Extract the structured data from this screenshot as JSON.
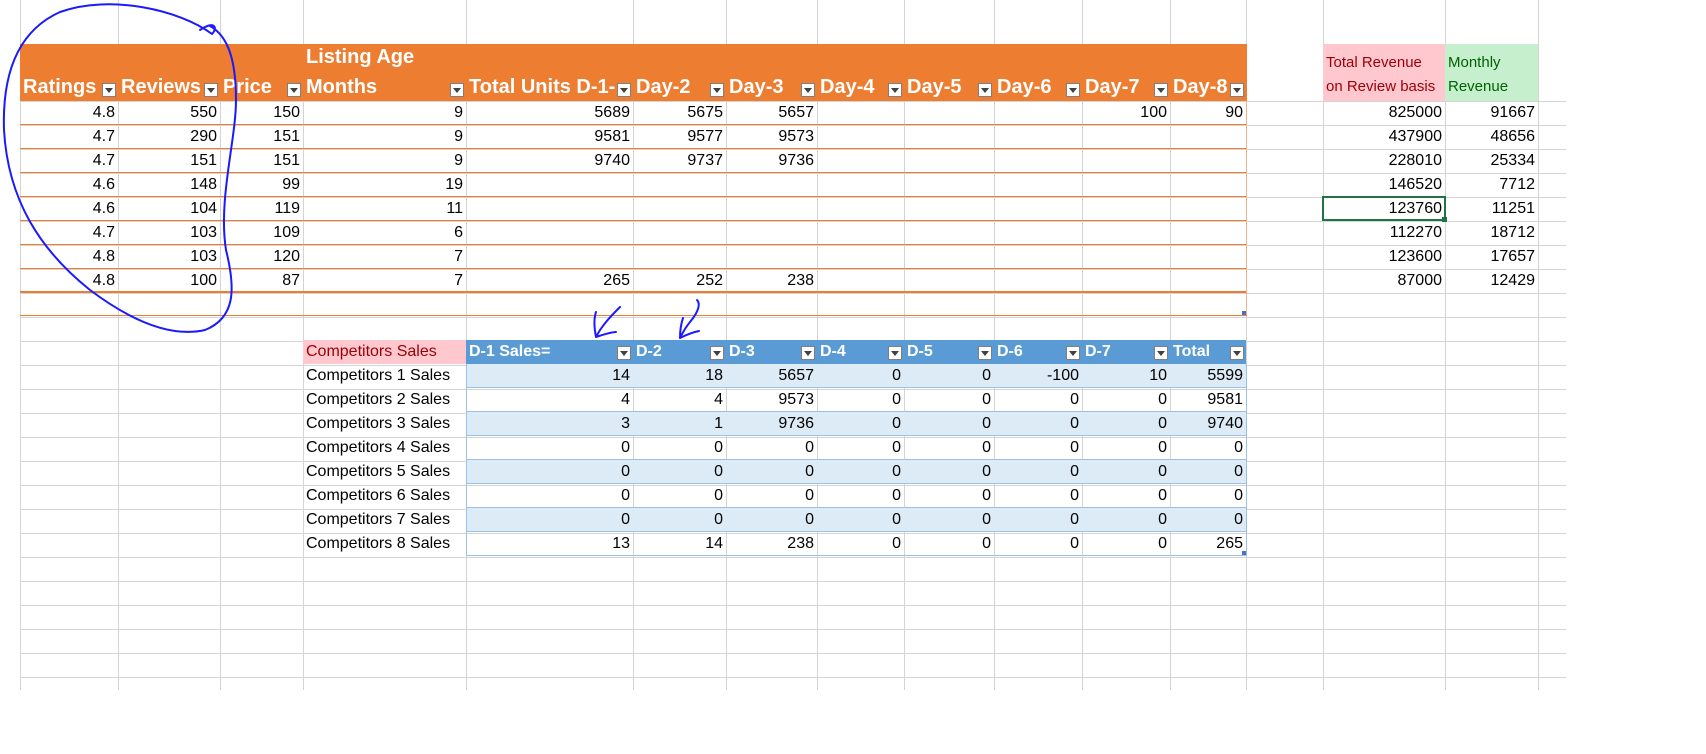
{
  "listing": {
    "group_header": "Listing Age",
    "columns": [
      "Ratings",
      "Reviews",
      "Price",
      "Months",
      "Total Units D-1-",
      "Day-2",
      "Day-3",
      "Day-4",
      "Day-5",
      "Day-6",
      "Day-7",
      "Day-8"
    ],
    "rows": [
      [
        "4.8",
        "550",
        "150",
        "9",
        "5689",
        "5675",
        "5657",
        "",
        "",
        "",
        "100",
        "90"
      ],
      [
        "4.7",
        "290",
        "151",
        "9",
        "9581",
        "9577",
        "9573",
        "",
        "",
        "",
        "",
        ""
      ],
      [
        "4.7",
        "151",
        "151",
        "9",
        "9740",
        "9737",
        "9736",
        "",
        "",
        "",
        "",
        ""
      ],
      [
        "4.6",
        "148",
        "99",
        "19",
        "",
        "",
        "",
        "",
        "",
        "",
        "",
        ""
      ],
      [
        "4.6",
        "104",
        "119",
        "11",
        "",
        "",
        "",
        "",
        "",
        "",
        "",
        ""
      ],
      [
        "4.7",
        "103",
        "109",
        "6",
        "",
        "",
        "",
        "",
        "",
        "",
        "",
        ""
      ],
      [
        "4.8",
        "103",
        "120",
        "7",
        "",
        "",
        "",
        "",
        "",
        "",
        "",
        ""
      ],
      [
        "4.8",
        "100",
        "87",
        "7",
        "265",
        "252",
        "238",
        "",
        "",
        "",
        "",
        ""
      ]
    ]
  },
  "revenue": {
    "total_header_line1": "Total Revenue",
    "total_header_line2": "on Review basis",
    "monthly_header_line1": "Monthly",
    "monthly_header_line2": "Revenue",
    "rows": [
      [
        "825000",
        "91667"
      ],
      [
        "437900",
        "48656"
      ],
      [
        "228010",
        "25334"
      ],
      [
        "146520",
        "7712"
      ],
      [
        "123760",
        "11251"
      ],
      [
        "112270",
        "18712"
      ],
      [
        "123600",
        "17657"
      ],
      [
        "87000",
        "12429"
      ]
    ]
  },
  "competitors": {
    "label_header": "Competitors Sales",
    "columns": [
      "D-1 Sales=",
      "D-2",
      "D-3",
      "D-4",
      "D-5",
      "D-6",
      "D-7",
      "Total"
    ],
    "rows": [
      {
        "label": "Competitors 1 Sales",
        "values": [
          "14",
          "18",
          "5657",
          "0",
          "0",
          "-100",
          "10",
          "5599"
        ]
      },
      {
        "label": "Competitors 2 Sales",
        "values": [
          "4",
          "4",
          "9573",
          "0",
          "0",
          "0",
          "0",
          "9581"
        ]
      },
      {
        "label": "Competitors 3 Sales",
        "values": [
          "3",
          "1",
          "9736",
          "0",
          "0",
          "0",
          "0",
          "9740"
        ]
      },
      {
        "label": "Competitors 4 Sales",
        "values": [
          "0",
          "0",
          "0",
          "0",
          "0",
          "0",
          "0",
          "0"
        ]
      },
      {
        "label": "Competitors 5 Sales",
        "values": [
          "0",
          "0",
          "0",
          "0",
          "0",
          "0",
          "0",
          "0"
        ]
      },
      {
        "label": "Competitors 6 Sales",
        "values": [
          "0",
          "0",
          "0",
          "0",
          "0",
          "0",
          "0",
          "0"
        ]
      },
      {
        "label": "Competitors 7 Sales",
        "values": [
          "0",
          "0",
          "0",
          "0",
          "0",
          "0",
          "0",
          "0"
        ]
      },
      {
        "label": "Competitors 8 Sales",
        "values": [
          "13",
          "14",
          "238",
          "0",
          "0",
          "0",
          "0",
          "265"
        ]
      }
    ]
  },
  "colors": {
    "orange_header": "#ed7d31",
    "orange_border": "#f4b183",
    "blue_header": "#5b9bd5",
    "blue_band": "#ddebf7",
    "blue_border": "#9bc2e6",
    "pink_fill": "#ffc7ce",
    "pink_text": "#9c0006",
    "green_fill": "#c6efce",
    "green_text": "#006100",
    "gridline": "#d4d4d4",
    "selection": "#217346",
    "annotation_ink": "#1a1aff"
  }
}
